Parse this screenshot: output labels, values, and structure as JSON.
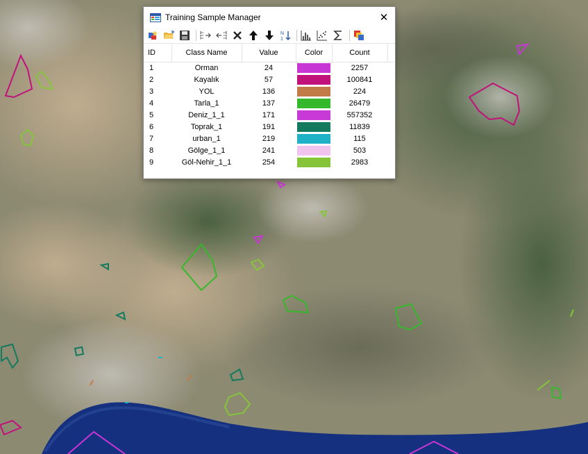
{
  "window": {
    "title": "Training Sample Manager",
    "close_symbol": "✕"
  },
  "toolbar": {
    "icons": [
      "new-class-icon",
      "open-icon",
      "save-icon",
      "merge-icon",
      "split-icon",
      "delete-icon",
      "move-up-icon",
      "move-down-icon",
      "sort-icon",
      "histogram-icon",
      "scatterplot-icon",
      "statistics-icon",
      "show-class-icon"
    ]
  },
  "table": {
    "headers": {
      "id": "ID",
      "class_name": "Class Name",
      "value": "Value",
      "color": "Color",
      "count": "Count"
    },
    "rows": [
      {
        "id": "1",
        "class_name": "Orman",
        "value": "24",
        "color": "#c936d6",
        "count": "2257"
      },
      {
        "id": "2",
        "class_name": "Kayalık",
        "value": "57",
        "color": "#c0127a",
        "count": "100841"
      },
      {
        "id": "3",
        "class_name": "YOL",
        "value": "136",
        "color": "#c17a48",
        "count": "224"
      },
      {
        "id": "4",
        "class_name": "Tarla_1",
        "value": "137",
        "color": "#36b82c",
        "count": "26479"
      },
      {
        "id": "5",
        "class_name": "Deniz_1_1",
        "value": "171",
        "color": "#c83ad8",
        "count": "557352"
      },
      {
        "id": "6",
        "class_name": "Toprak_1",
        "value": "191",
        "color": "#147a5e",
        "count": "11839"
      },
      {
        "id": "7",
        "class_name": "urban_1",
        "value": "219",
        "color": "#1fb2c6",
        "count": "115"
      },
      {
        "id": "8",
        "class_name": "Gölge_1_1",
        "value": "241",
        "color": "#f0c4ef",
        "count": "503"
      },
      {
        "id": "9",
        "class_name": "Göl-Nehir_1_1",
        "value": "254",
        "color": "#86c53a",
        "count": "2983"
      }
    ]
  }
}
